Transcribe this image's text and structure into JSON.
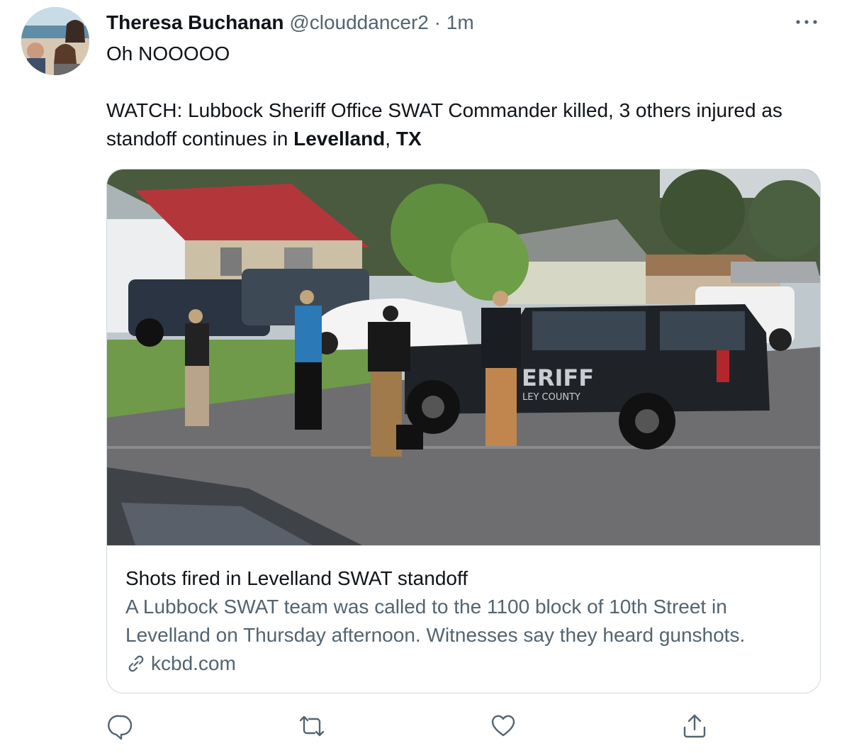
{
  "tweet": {
    "author_name": "Theresa Buchanan",
    "handle": "@clouddancer2",
    "separator": "·",
    "time": "1m",
    "text_line1": "Oh NOOOOO",
    "text_line2_prefix": "WATCH: Lubbock Sheriff Office SWAT Commander killed, 3 others injured as standoff continues in ",
    "text_bold_place": "Levelland",
    "text_comma": ", ",
    "text_bold_state": "TX"
  },
  "card": {
    "title": "Shots fired in Levelland SWAT standoff",
    "description": "A Lubbock SWAT team was called to the 1100 block of 10th Street in Levelland on Thursday afternoon. Witnesses say they heard gunshots.",
    "domain": "kcbd.com",
    "image_vehicle_text": "ERIFF",
    "image_vehicle_subtext": "LEY COUNTY"
  },
  "icons": {
    "more": "more-icon",
    "reply": "reply-icon",
    "retweet": "retweet-icon",
    "like": "like-icon",
    "share": "share-icon",
    "link": "link-icon"
  },
  "colors": {
    "text_primary": "#0f1419",
    "text_secondary": "#536471",
    "border": "#cfd9de"
  }
}
